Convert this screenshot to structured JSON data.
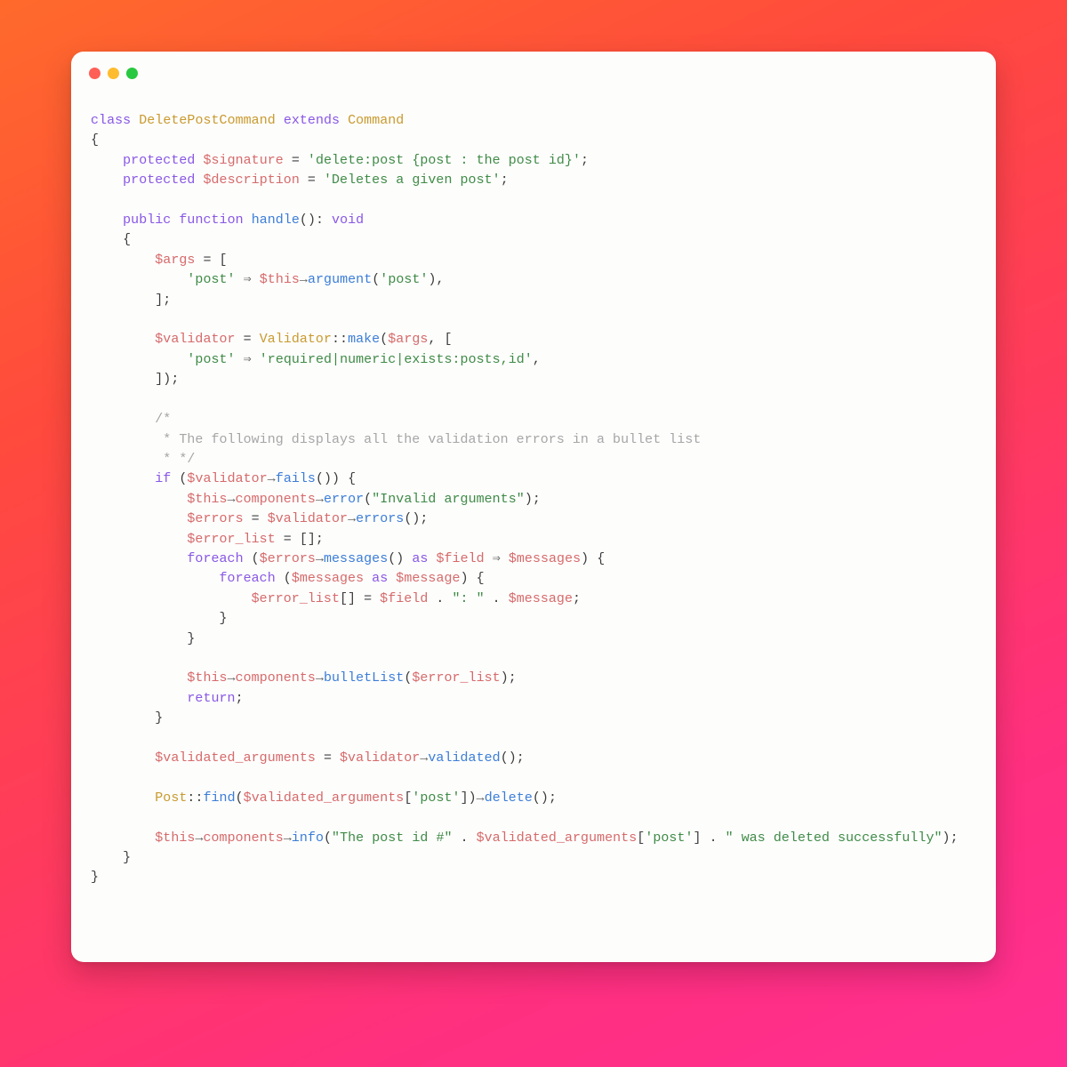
{
  "code": {
    "t": {
      "class": "class",
      "extends": "extends",
      "protected": "protected",
      "public": "public",
      "function": "function",
      "void": "void",
      "if": "if",
      "foreach": "foreach",
      "as": "as",
      "return": "return",
      "arrow": "→",
      "darrow": "⇒"
    },
    "ident": {
      "DeletePostCommand": "DeletePostCommand",
      "Command": "Command",
      "Validator": "Validator",
      "Post": "Post",
      "handle": "handle",
      "argument": "argument",
      "make": "make",
      "fails": "fails",
      "error": "error",
      "errors": "errors",
      "messages": "messages",
      "bulletList": "bulletList",
      "validated": "validated",
      "find": "find",
      "delete": "delete",
      "info": "info",
      "components": "components"
    },
    "vars": {
      "signature": "$signature",
      "description": "$description",
      "args": "$args",
      "this": "$this",
      "validator": "$validator",
      "errors": "$errors",
      "error_list": "$error_list",
      "field": "$field",
      "messages": "$messages",
      "message": "$message",
      "validated_arguments": "$validated_arguments"
    },
    "str": {
      "signature": "'delete:post {post : the post id}'",
      "description": "'Deletes a given post'",
      "post_key": "'post'",
      "rules": "'required|numeric|exists:posts,id'",
      "invalid_args": "\"Invalid arguments\"",
      "colon_sep": "\": \"",
      "info_prefix": "\"The post id #\"",
      "info_suffix": "\" was deleted successfully\""
    },
    "cmt": {
      "l1": "/*",
      "l2": " * The following displays all the validation errors in a bullet list",
      "l3": " * */"
    }
  }
}
